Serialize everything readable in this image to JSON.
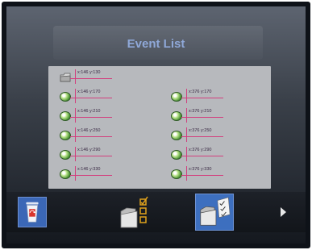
{
  "header": {
    "title": "Event List"
  },
  "events": {
    "left": [
      {
        "label": "x:146 y:130",
        "icon": "folder-icon"
      },
      {
        "label": "x:146 y:170",
        "icon": "globe-icon"
      },
      {
        "label": "x:146 y:210",
        "icon": "globe-icon"
      },
      {
        "label": "x:146 y:250",
        "icon": "globe-icon"
      },
      {
        "label": "x:146 y:290",
        "icon": "globe-icon"
      },
      {
        "label": "x:146 y:330",
        "icon": "globe-icon"
      }
    ],
    "right": [
      {
        "label": "x:376 y:170",
        "icon": "globe-icon"
      },
      {
        "label": "x:376 y:210",
        "icon": "globe-icon"
      },
      {
        "label": "x:376 y:250",
        "icon": "globe-icon"
      },
      {
        "label": "x:376 y:290",
        "icon": "globe-icon"
      },
      {
        "label": "x:376 y:330",
        "icon": "globe-icon"
      }
    ]
  },
  "toolbar": {
    "buttons": [
      {
        "name": "recycle-bin",
        "icon": "recycle-bin-icon"
      },
      {
        "name": "folder-checklist",
        "icon": "folder-checklist-icon"
      },
      {
        "name": "folder-checklist-selected",
        "icon": "folder-checked-list-icon",
        "selected": true
      },
      {
        "name": "next",
        "icon": "arrow-right-icon"
      }
    ]
  },
  "colors": {
    "accent": "#3d6fbf",
    "title": "#8fa8d8",
    "marker": "#d2407e",
    "panel": "#b7b9bd"
  }
}
